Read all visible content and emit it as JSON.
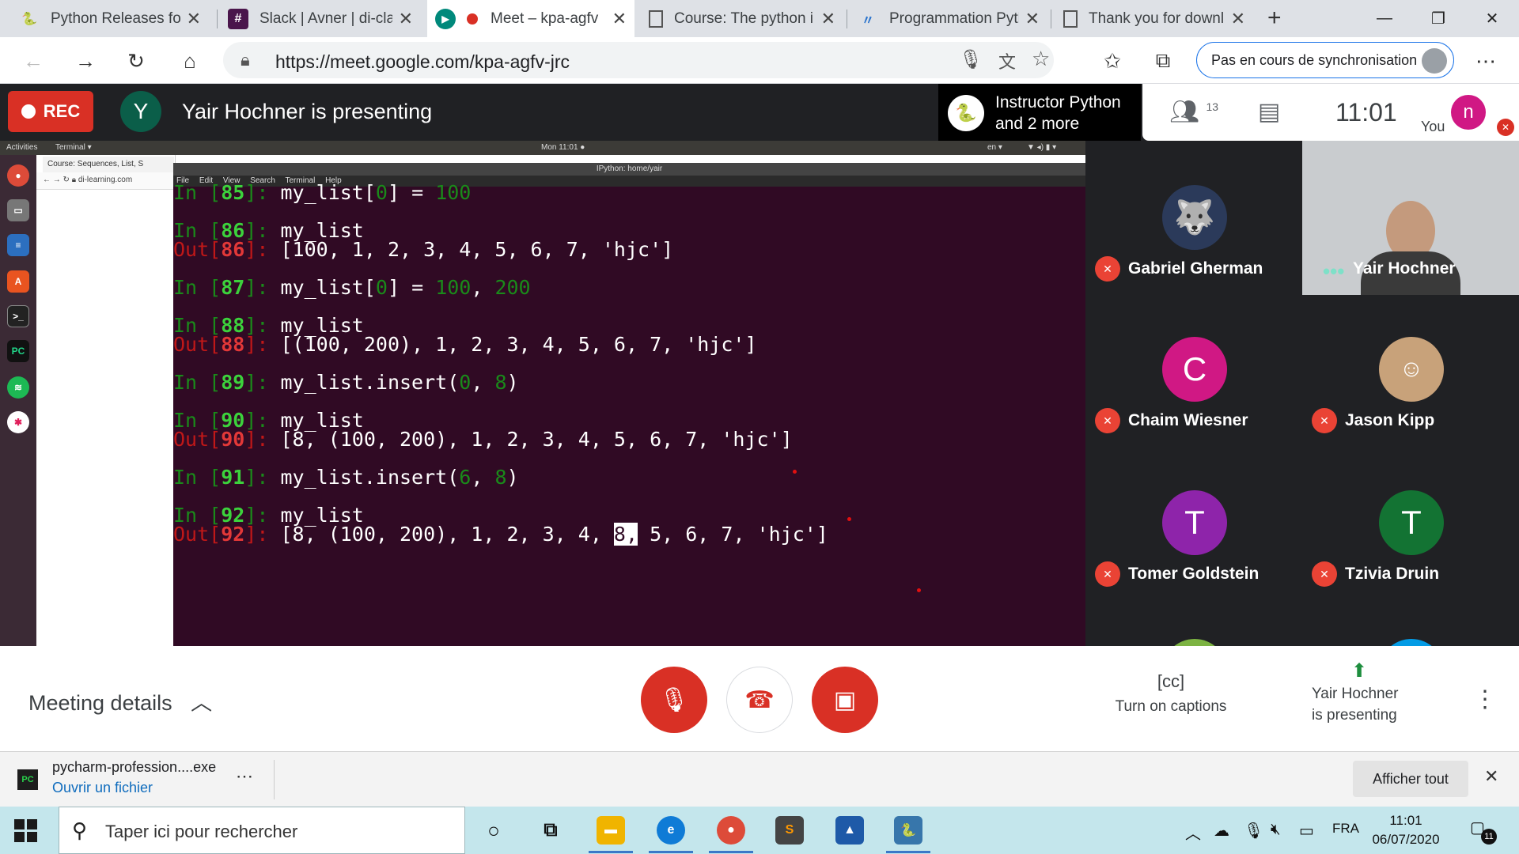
{
  "browser": {
    "tabs": [
      {
        "title": "Python Releases for W",
        "icon": "python-icon",
        "active": false
      },
      {
        "title": "Slack | Avner | di-clas",
        "icon": "slack-icon",
        "active": false
      },
      {
        "title": "Meet – kpa-agfv",
        "icon": "google-meet-icon",
        "active": true
      },
      {
        "title": "Course: The python i",
        "icon": "document-icon",
        "active": false
      },
      {
        "title": "Programmation Pyth",
        "icon": "coursera-icon",
        "active": false
      },
      {
        "title": "Thank you for downl",
        "icon": "document-icon",
        "active": false
      }
    ],
    "url": "https://meet.google.com/kpa-agfv-jrc",
    "sync_label": "Pas en cours de synchronisation"
  },
  "meet": {
    "rec_label": "REC",
    "presenter_initial": "Y",
    "presenting_text": "Yair Hochner is presenting",
    "pinned_line1": "Instructor Python",
    "pinned_line2": "and 2 more",
    "participant_count": "13",
    "time": "11:01",
    "you_label": "You",
    "you_initial": "n",
    "participants": [
      {
        "name": "Gabriel Gherman",
        "initial": "",
        "color": "#2b3a5a",
        "muted": true
      },
      {
        "name": "Yair Hochner",
        "initial": "",
        "color": "",
        "muted": false,
        "speaking": true
      },
      {
        "name": "Chaim Wiesner",
        "initial": "C",
        "color": "#d01884",
        "muted": true
      },
      {
        "name": "Jason Kipp",
        "initial": "",
        "color": "#c8a27a",
        "muted": true
      },
      {
        "name": "Tomer Goldstein",
        "initial": "T",
        "color": "#8e24aa",
        "muted": true
      },
      {
        "name": "Tzivia Druin",
        "initial": "T",
        "color": "#137333",
        "muted": true
      }
    ],
    "meeting_details": "Meeting details",
    "captions_label": "Turn on captions",
    "presenting_btn_line1": "Yair Hochner",
    "presenting_btn_line2": "is presenting"
  },
  "shared_screen": {
    "ubuntu_activities": "Activities",
    "ubuntu_app": "Terminal ▾",
    "ubuntu_clock": "Mon 11:01 ●",
    "ubuntu_lang": "en ▾",
    "chrome_tab": "Course: Sequences, List, S",
    "chrome_url": "di-learning.com",
    "term_title": "IPython: home/yair",
    "term_menu": [
      "File",
      "Edit",
      "View",
      "Search",
      "Terminal",
      "Help"
    ],
    "ipython": [
      {
        "type": "in",
        "n": "85",
        "code": [
          [
            "my_list[",
            ""
          ],
          [
            "0",
            "num"
          ],
          [
            "] = ",
            ""
          ],
          [
            "100",
            "num"
          ]
        ]
      },
      {
        "type": "gap"
      },
      {
        "type": "in",
        "n": "86",
        "code": [
          [
            "my_list",
            ""
          ]
        ]
      },
      {
        "type": "out",
        "n": "86",
        "code": [
          [
            "[100, 1, 2, 3, 4, 5, 6, 7, 'hjc']",
            ""
          ]
        ]
      },
      {
        "type": "gap"
      },
      {
        "type": "in",
        "n": "87",
        "code": [
          [
            "my_list[",
            ""
          ],
          [
            "0",
            "num"
          ],
          [
            "] = ",
            ""
          ],
          [
            "100",
            "num"
          ],
          [
            ", ",
            ""
          ],
          [
            "200",
            "num"
          ]
        ]
      },
      {
        "type": "gap"
      },
      {
        "type": "in",
        "n": "88",
        "code": [
          [
            "my_list",
            ""
          ]
        ]
      },
      {
        "type": "out",
        "n": "88",
        "code": [
          [
            "[(100, 200), 1, 2, 3, 4, 5, 6, 7, 'hjc']",
            ""
          ]
        ]
      },
      {
        "type": "gap"
      },
      {
        "type": "in",
        "n": "89",
        "code": [
          [
            "my_list.insert(",
            ""
          ],
          [
            "0",
            "num"
          ],
          [
            ", ",
            ""
          ],
          [
            "8",
            "num"
          ],
          [
            ")",
            ""
          ]
        ]
      },
      {
        "type": "gap"
      },
      {
        "type": "in",
        "n": "90",
        "code": [
          [
            "my_list",
            ""
          ]
        ]
      },
      {
        "type": "out",
        "n": "90",
        "code": [
          [
            "[8, (100, 200), 1, 2, 3, 4, 5, 6, 7, 'hjc']",
            ""
          ]
        ]
      },
      {
        "type": "gap"
      },
      {
        "type": "in",
        "n": "91",
        "code": [
          [
            "my_list.insert(",
            ""
          ],
          [
            "6",
            "num"
          ],
          [
            ", ",
            ""
          ],
          [
            "8",
            "num"
          ],
          [
            ")",
            ""
          ]
        ]
      },
      {
        "type": "gap"
      },
      {
        "type": "in",
        "n": "92",
        "code": [
          [
            "my_list",
            ""
          ]
        ]
      },
      {
        "type": "out",
        "n": "92",
        "code": [
          [
            "[8, (100, 200), 1, 2, 3, 4, ",
            ""
          ],
          [
            "8,",
            "cursorch"
          ],
          [
            " 5, 6, 7, 'hjc']",
            ""
          ]
        ]
      }
    ],
    "in_prefix": "In [",
    "out_prefix": "Out[",
    "prompt_suffix": "]: "
  },
  "download": {
    "filename": "pycharm-profession....exe",
    "open_label": "Ouvrir un fichier",
    "show_all": "Afficher tout"
  },
  "taskbar": {
    "search_placeholder": "Taper ici pour rechercher",
    "lang": "FRA",
    "time": "11:01",
    "date": "06/07/2020",
    "notification_count": "11"
  },
  "colors": {
    "meet_dark": "#202124",
    "rec_red": "#d93025",
    "terminal_bg": "#300a24",
    "accent_blue": "#1a73e8"
  }
}
